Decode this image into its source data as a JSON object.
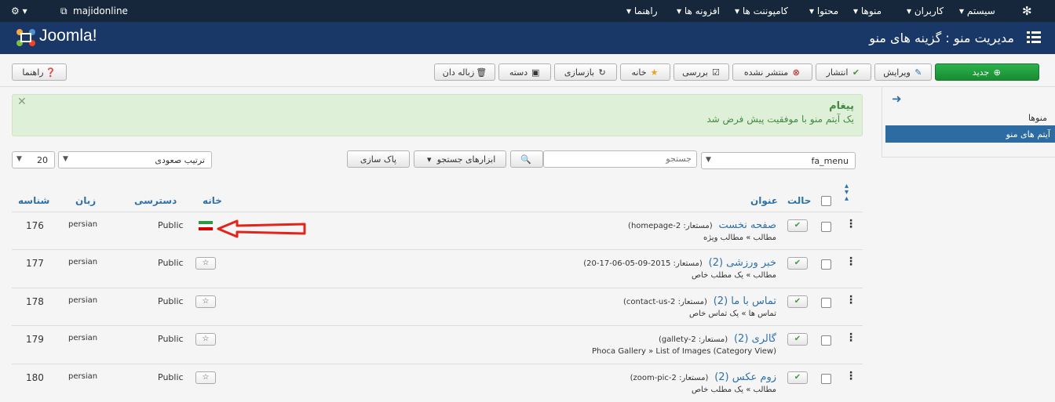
{
  "topnav": {
    "user": "majidonline",
    "menus": [
      "سیستم",
      "کاربران",
      "منوها",
      "محتوا",
      "کامپوننت ها",
      "افزونه ها",
      "راهنما"
    ]
  },
  "header": {
    "logo": "Joomla!",
    "title": "مدیریت منو : گزینه های منو"
  },
  "toolbar": {
    "new": "جدید",
    "edit": "ویرایش",
    "publish": "انتشار",
    "unpublish": "منتشر نشده",
    "check": "بررسی",
    "home": "خانه",
    "rebuild": "بازسازی",
    "batch": "دسته",
    "trash": "زباله دان",
    "help": "راهنما"
  },
  "sidebar": {
    "items": [
      "منوها",
      "آیتم های منو"
    ]
  },
  "message": {
    "heading": "پیغام",
    "text": "یک آیتم منو با موفقیت پیش فرض شد"
  },
  "filters": {
    "menu": "fa_menu",
    "search_placeholder": "جستجو",
    "search_tools": "ابزارهای جستجو",
    "clear": "پاک سازی",
    "sort": "ترتیب صعودی",
    "limit": "20"
  },
  "columns": {
    "status": "حالت",
    "title": "عنوان",
    "home": "خانه",
    "access": "دسترسی",
    "language": "زبان",
    "id": "شناسه"
  },
  "rows": [
    {
      "title": "صفحه نخست",
      "alias": "(مستعار: homepage-2)",
      "type": "مطالب » مطالب ویژه",
      "access": "Public",
      "language": "persian",
      "id": "176"
    },
    {
      "title": "خبر ورزشی (2)",
      "alias": "(مستعار: 2015-09-05-06-17-20)",
      "type": "مطالب » یک مطلب خاص",
      "access": "Public",
      "language": "persian",
      "id": "177"
    },
    {
      "title": "تماس با ما (2)",
      "alias": "(مستعار: contact-us-2)",
      "type": "تماس ها » یک تماس خاص",
      "access": "Public",
      "language": "persian",
      "id": "178"
    },
    {
      "title": "گالری (2)",
      "alias": "(مستعار: gallety-2)",
      "type": "Phoca Gallery » List of Images (Category View)",
      "access": "Public",
      "language": "persian",
      "id": "179"
    },
    {
      "title": "زوم عکس (2)",
      "alias": "(مستعار: zoom-pic-2)",
      "type": "مطالب » یک مطلب خاص",
      "access": "Public",
      "language": "persian",
      "id": "180"
    }
  ]
}
